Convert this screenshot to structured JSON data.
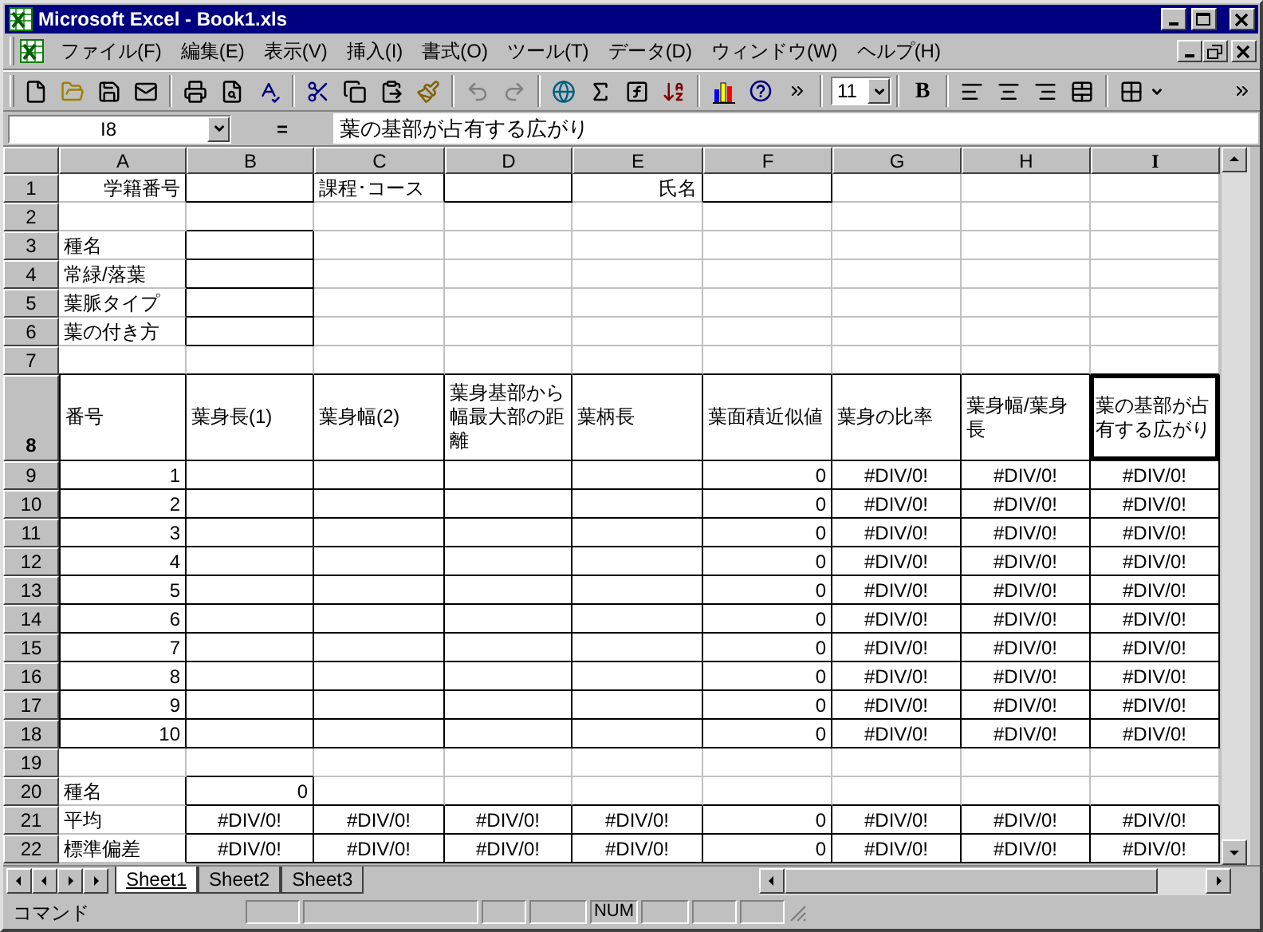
{
  "window": {
    "title": "Microsoft Excel - Book1.xls"
  },
  "menu": [
    "ファイル(F)",
    "編集(E)",
    "表示(V)",
    "挿入(I)",
    "書式(O)",
    "ツール(T)",
    "データ(D)",
    "ウィンドウ(W)",
    "ヘルプ(H)"
  ],
  "toolbar": {
    "font_size": "11",
    "bold": "B"
  },
  "formula_bar": {
    "name_box": "I8",
    "equals": "=",
    "value": "葉の基部が占有する広がり"
  },
  "columns": [
    {
      "label": "A",
      "selected": false
    },
    {
      "label": "B",
      "selected": false
    },
    {
      "label": "C",
      "selected": false
    },
    {
      "label": "D",
      "selected": false
    },
    {
      "label": "E",
      "selected": false
    },
    {
      "label": "F",
      "selected": false
    },
    {
      "label": "G",
      "selected": false
    },
    {
      "label": "H",
      "selected": false
    },
    {
      "label": "I",
      "selected": true
    }
  ],
  "rows": [
    {
      "label": "1",
      "selected": false,
      "cells": [
        {
          "kind": "value",
          "text": "学籍番号",
          "boxed": false
        },
        {
          "kind": "blank",
          "boxed": true
        },
        {
          "kind": "label",
          "text": "課程･コース",
          "boxed": false
        },
        {
          "kind": "blank",
          "boxed": true
        },
        {
          "kind": "value",
          "text": "氏名",
          "boxed": false
        },
        {
          "kind": "blank",
          "boxed": true
        },
        {
          "kind": "blank",
          "boxed": false
        },
        {
          "kind": "blank",
          "boxed": false
        },
        {
          "kind": "blank",
          "boxed": false
        }
      ]
    },
    {
      "label": "2",
      "selected": false,
      "cells": [
        {
          "kind": "blank",
          "boxed": false
        },
        {
          "kind": "blank",
          "boxed": false
        },
        {
          "kind": "blank",
          "boxed": false
        },
        {
          "kind": "blank",
          "boxed": false
        },
        {
          "kind": "blank",
          "boxed": false
        },
        {
          "kind": "blank",
          "boxed": false
        },
        {
          "kind": "blank",
          "boxed": false
        },
        {
          "kind": "blank",
          "boxed": false
        },
        {
          "kind": "blank",
          "boxed": false
        }
      ]
    },
    {
      "label": "3",
      "selected": false,
      "cells": [
        {
          "kind": "label",
          "text": "種名",
          "boxed": false
        },
        {
          "kind": "blank",
          "boxed": true
        },
        {
          "kind": "blank",
          "boxed": false
        },
        {
          "kind": "blank",
          "boxed": false
        },
        {
          "kind": "blank",
          "boxed": false
        },
        {
          "kind": "blank",
          "boxed": false
        },
        {
          "kind": "blank",
          "boxed": false
        },
        {
          "kind": "blank",
          "boxed": false
        },
        {
          "kind": "blank",
          "boxed": false
        }
      ]
    },
    {
      "label": "4",
      "selected": false,
      "cells": [
        {
          "kind": "label",
          "text": "常緑/落葉",
          "boxed": false
        },
        {
          "kind": "blank",
          "boxed": true
        },
        {
          "kind": "blank",
          "boxed": false
        },
        {
          "kind": "blank",
          "boxed": false
        },
        {
          "kind": "blank",
          "boxed": false
        },
        {
          "kind": "blank",
          "boxed": false
        },
        {
          "kind": "blank",
          "boxed": false
        },
        {
          "kind": "blank",
          "boxed": false
        },
        {
          "kind": "blank",
          "boxed": false
        }
      ]
    },
    {
      "label": "5",
      "selected": false,
      "cells": [
        {
          "kind": "label",
          "text": "葉脈タイプ",
          "boxed": false
        },
        {
          "kind": "blank",
          "boxed": true
        },
        {
          "kind": "blank",
          "boxed": false
        },
        {
          "kind": "blank",
          "boxed": false
        },
        {
          "kind": "blank",
          "boxed": false
        },
        {
          "kind": "blank",
          "boxed": false
        },
        {
          "kind": "blank",
          "boxed": false
        },
        {
          "kind": "blank",
          "boxed": false
        },
        {
          "kind": "blank",
          "boxed": false
        }
      ]
    },
    {
      "label": "6",
      "selected": false,
      "cells": [
        {
          "kind": "label",
          "text": "葉の付き方",
          "boxed": false
        },
        {
          "kind": "blank",
          "boxed": true
        },
        {
          "kind": "blank",
          "boxed": false
        },
        {
          "kind": "blank",
          "boxed": false
        },
        {
          "kind": "blank",
          "boxed": false
        },
        {
          "kind": "blank",
          "boxed": false
        },
        {
          "kind": "blank",
          "boxed": false
        },
        {
          "kind": "blank",
          "boxed": false
        },
        {
          "kind": "blank",
          "boxed": false
        }
      ]
    },
    {
      "label": "7",
      "selected": false,
      "cells": [
        {
          "kind": "blank",
          "boxed": false
        },
        {
          "kind": "blank",
          "boxed": false
        },
        {
          "kind": "blank",
          "boxed": false
        },
        {
          "kind": "blank",
          "boxed": false
        },
        {
          "kind": "blank",
          "boxed": false
        },
        {
          "kind": "blank",
          "boxed": false
        },
        {
          "kind": "blank",
          "boxed": false
        },
        {
          "kind": "blank",
          "boxed": false
        },
        {
          "kind": "blank",
          "boxed": false
        }
      ]
    },
    {
      "label": "8",
      "selected": true,
      "cells": [
        {
          "kind": "header",
          "text": "番号",
          "boxed": true
        },
        {
          "kind": "header",
          "text": "葉身長(1)",
          "boxed": true
        },
        {
          "kind": "header",
          "text": "葉身幅(2)",
          "boxed": true
        },
        {
          "kind": "header",
          "text": "葉身基部から幅最大部の距離",
          "boxed": true
        },
        {
          "kind": "header",
          "text": "葉柄長",
          "boxed": true
        },
        {
          "kind": "header",
          "text": "葉面積近似値",
          "boxed": true
        },
        {
          "kind": "header",
          "text": "葉身の比率",
          "boxed": true
        },
        {
          "kind": "header",
          "text": "葉身幅/葉身長",
          "boxed": true
        },
        {
          "kind": "header",
          "text": "葉の基部が占有する広がり",
          "boxed": true
        }
      ]
    },
    {
      "label": "9",
      "selected": false,
      "cells": [
        {
          "kind": "value",
          "text": "1",
          "boxed": true
        },
        {
          "kind": "blank",
          "boxed": true
        },
        {
          "kind": "blank",
          "boxed": true
        },
        {
          "kind": "blank",
          "boxed": true
        },
        {
          "kind": "blank",
          "boxed": true
        },
        {
          "kind": "value",
          "text": "0",
          "boxed": true
        },
        {
          "kind": "error",
          "text": "#DIV/0!",
          "boxed": true
        },
        {
          "kind": "error",
          "text": "#DIV/0!",
          "boxed": true
        },
        {
          "kind": "error",
          "text": "#DIV/0!",
          "boxed": true
        }
      ]
    },
    {
      "label": "10",
      "selected": false,
      "cells": [
        {
          "kind": "value",
          "text": "2",
          "boxed": true
        },
        {
          "kind": "blank",
          "boxed": true
        },
        {
          "kind": "blank",
          "boxed": true
        },
        {
          "kind": "blank",
          "boxed": true
        },
        {
          "kind": "blank",
          "boxed": true
        },
        {
          "kind": "value",
          "text": "0",
          "boxed": true
        },
        {
          "kind": "error",
          "text": "#DIV/0!",
          "boxed": true
        },
        {
          "kind": "error",
          "text": "#DIV/0!",
          "boxed": true
        },
        {
          "kind": "error",
          "text": "#DIV/0!",
          "boxed": true
        }
      ]
    },
    {
      "label": "11",
      "selected": false,
      "cells": [
        {
          "kind": "value",
          "text": "3",
          "boxed": true
        },
        {
          "kind": "blank",
          "boxed": true
        },
        {
          "kind": "blank",
          "boxed": true
        },
        {
          "kind": "blank",
          "boxed": true
        },
        {
          "kind": "blank",
          "boxed": true
        },
        {
          "kind": "value",
          "text": "0",
          "boxed": true
        },
        {
          "kind": "error",
          "text": "#DIV/0!",
          "boxed": true
        },
        {
          "kind": "error",
          "text": "#DIV/0!",
          "boxed": true
        },
        {
          "kind": "error",
          "text": "#DIV/0!",
          "boxed": true
        }
      ]
    },
    {
      "label": "12",
      "selected": false,
      "cells": [
        {
          "kind": "value",
          "text": "4",
          "boxed": true
        },
        {
          "kind": "blank",
          "boxed": true
        },
        {
          "kind": "blank",
          "boxed": true
        },
        {
          "kind": "blank",
          "boxed": true
        },
        {
          "kind": "blank",
          "boxed": true
        },
        {
          "kind": "value",
          "text": "0",
          "boxed": true
        },
        {
          "kind": "error",
          "text": "#DIV/0!",
          "boxed": true
        },
        {
          "kind": "error",
          "text": "#DIV/0!",
          "boxed": true
        },
        {
          "kind": "error",
          "text": "#DIV/0!",
          "boxed": true
        }
      ]
    },
    {
      "label": "13",
      "selected": false,
      "cells": [
        {
          "kind": "value",
          "text": "5",
          "boxed": true
        },
        {
          "kind": "blank",
          "boxed": true
        },
        {
          "kind": "blank",
          "boxed": true
        },
        {
          "kind": "blank",
          "boxed": true
        },
        {
          "kind": "blank",
          "boxed": true
        },
        {
          "kind": "value",
          "text": "0",
          "boxed": true
        },
        {
          "kind": "error",
          "text": "#DIV/0!",
          "boxed": true
        },
        {
          "kind": "error",
          "text": "#DIV/0!",
          "boxed": true
        },
        {
          "kind": "error",
          "text": "#DIV/0!",
          "boxed": true
        }
      ]
    },
    {
      "label": "14",
      "selected": false,
      "cells": [
        {
          "kind": "value",
          "text": "6",
          "boxed": true
        },
        {
          "kind": "blank",
          "boxed": true
        },
        {
          "kind": "blank",
          "boxed": true
        },
        {
          "kind": "blank",
          "boxed": true
        },
        {
          "kind": "blank",
          "boxed": true
        },
        {
          "kind": "value",
          "text": "0",
          "boxed": true
        },
        {
          "kind": "error",
          "text": "#DIV/0!",
          "boxed": true
        },
        {
          "kind": "error",
          "text": "#DIV/0!",
          "boxed": true
        },
        {
          "kind": "error",
          "text": "#DIV/0!",
          "boxed": true
        }
      ]
    },
    {
      "label": "15",
      "selected": false,
      "cells": [
        {
          "kind": "value",
          "text": "7",
          "boxed": true
        },
        {
          "kind": "blank",
          "boxed": true
        },
        {
          "kind": "blank",
          "boxed": true
        },
        {
          "kind": "blank",
          "boxed": true
        },
        {
          "kind": "blank",
          "boxed": true
        },
        {
          "kind": "value",
          "text": "0",
          "boxed": true
        },
        {
          "kind": "error",
          "text": "#DIV/0!",
          "boxed": true
        },
        {
          "kind": "error",
          "text": "#DIV/0!",
          "boxed": true
        },
        {
          "kind": "error",
          "text": "#DIV/0!",
          "boxed": true
        }
      ]
    },
    {
      "label": "16",
      "selected": false,
      "cells": [
        {
          "kind": "value",
          "text": "8",
          "boxed": true
        },
        {
          "kind": "blank",
          "boxed": true
        },
        {
          "kind": "blank",
          "boxed": true
        },
        {
          "kind": "blank",
          "boxed": true
        },
        {
          "kind": "blank",
          "boxed": true
        },
        {
          "kind": "value",
          "text": "0",
          "boxed": true
        },
        {
          "kind": "error",
          "text": "#DIV/0!",
          "boxed": true
        },
        {
          "kind": "error",
          "text": "#DIV/0!",
          "boxed": true
        },
        {
          "kind": "error",
          "text": "#DIV/0!",
          "boxed": true
        }
      ]
    },
    {
      "label": "17",
      "selected": false,
      "cells": [
        {
          "kind": "value",
          "text": "9",
          "boxed": true
        },
        {
          "kind": "blank",
          "boxed": true
        },
        {
          "kind": "blank",
          "boxed": true
        },
        {
          "kind": "blank",
          "boxed": true
        },
        {
          "kind": "blank",
          "boxed": true
        },
        {
          "kind": "value",
          "text": "0",
          "boxed": true
        },
        {
          "kind": "error",
          "text": "#DIV/0!",
          "boxed": true
        },
        {
          "kind": "error",
          "text": "#DIV/0!",
          "boxed": true
        },
        {
          "kind": "error",
          "text": "#DIV/0!",
          "boxed": true
        }
      ]
    },
    {
      "label": "18",
      "selected": false,
      "cells": [
        {
          "kind": "value",
          "text": "10",
          "boxed": true
        },
        {
          "kind": "blank",
          "boxed": true
        },
        {
          "kind": "blank",
          "boxed": true
        },
        {
          "kind": "blank",
          "boxed": true
        },
        {
          "kind": "blank",
          "boxed": true
        },
        {
          "kind": "value",
          "text": "0",
          "boxed": true
        },
        {
          "kind": "error",
          "text": "#DIV/0!",
          "boxed": true
        },
        {
          "kind": "error",
          "text": "#DIV/0!",
          "boxed": true
        },
        {
          "kind": "error",
          "text": "#DIV/0!",
          "boxed": true
        }
      ]
    },
    {
      "label": "19",
      "selected": false,
      "cells": [
        {
          "kind": "blank",
          "boxed": false
        },
        {
          "kind": "blank",
          "boxed": false
        },
        {
          "kind": "blank",
          "boxed": false
        },
        {
          "kind": "blank",
          "boxed": false
        },
        {
          "kind": "blank",
          "boxed": false
        },
        {
          "kind": "blank",
          "boxed": false
        },
        {
          "kind": "blank",
          "boxed": false
        },
        {
          "kind": "blank",
          "boxed": false
        },
        {
          "kind": "blank",
          "boxed": false
        }
      ]
    },
    {
      "label": "20",
      "selected": false,
      "cells": [
        {
          "kind": "label",
          "text": "種名",
          "boxed": false
        },
        {
          "kind": "value",
          "text": "0",
          "boxed": true
        },
        {
          "kind": "blank",
          "boxed": false
        },
        {
          "kind": "blank",
          "boxed": false
        },
        {
          "kind": "blank",
          "boxed": false
        },
        {
          "kind": "blank",
          "boxed": false
        },
        {
          "kind": "blank",
          "boxed": false
        },
        {
          "kind": "blank",
          "boxed": false
        },
        {
          "kind": "blank",
          "boxed": false
        }
      ]
    },
    {
      "label": "21",
      "selected": false,
      "cells": [
        {
          "kind": "label",
          "text": "平均",
          "boxed": false
        },
        {
          "kind": "error",
          "text": "#DIV/0!",
          "boxed": true
        },
        {
          "kind": "error",
          "text": "#DIV/0!",
          "boxed": true
        },
        {
          "kind": "error",
          "text": "#DIV/0!",
          "boxed": true
        },
        {
          "kind": "error",
          "text": "#DIV/0!",
          "boxed": true
        },
        {
          "kind": "value",
          "text": "0",
          "boxed": true
        },
        {
          "kind": "error",
          "text": "#DIV/0!",
          "boxed": true
        },
        {
          "kind": "error",
          "text": "#DIV/0!",
          "boxed": true
        },
        {
          "kind": "error",
          "text": "#DIV/0!",
          "boxed": true
        }
      ]
    },
    {
      "label": "22",
      "selected": false,
      "cells": [
        {
          "kind": "label",
          "text": "標準偏差",
          "boxed": false
        },
        {
          "kind": "error",
          "text": "#DIV/0!",
          "boxed": true
        },
        {
          "kind": "error",
          "text": "#DIV/0!",
          "boxed": true
        },
        {
          "kind": "error",
          "text": "#DIV/0!",
          "boxed": true
        },
        {
          "kind": "error",
          "text": "#DIV/0!",
          "boxed": true
        },
        {
          "kind": "value",
          "text": "0",
          "boxed": true
        },
        {
          "kind": "error",
          "text": "#DIV/0!",
          "boxed": true
        },
        {
          "kind": "error",
          "text": "#DIV/0!",
          "boxed": true
        },
        {
          "kind": "error",
          "text": "#DIV/0!",
          "boxed": true
        }
      ]
    }
  ],
  "sheet_tabs": [
    {
      "label": "Sheet1",
      "selected": true
    },
    {
      "label": "Sheet2",
      "selected": false
    },
    {
      "label": "Sheet3",
      "selected": false
    }
  ],
  "status_bar": {
    "text": "コマンド",
    "num": "NUM"
  }
}
